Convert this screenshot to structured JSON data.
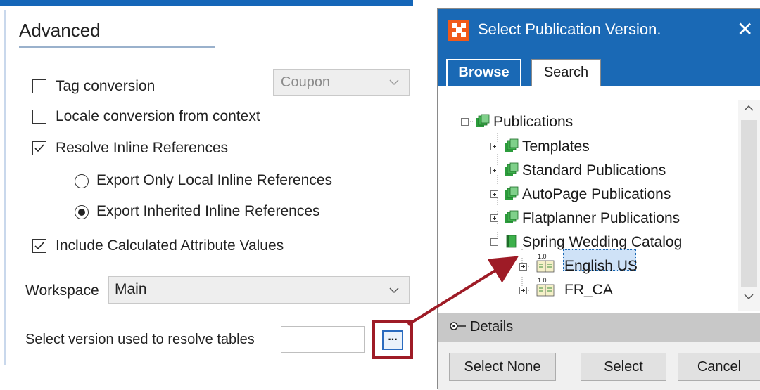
{
  "advanced": {
    "title": "Advanced",
    "tag_conversion": {
      "label": "Tag conversion",
      "checked": false
    },
    "coupon_select": {
      "value": "Coupon"
    },
    "locale_conversion": {
      "label": "Locale conversion from context",
      "checked": false
    },
    "resolve_inline": {
      "label": "Resolve Inline References",
      "checked": true
    },
    "radio_local": {
      "label": "Export Only Local Inline References",
      "selected": false
    },
    "radio_inherited": {
      "label": "Export Inherited Inline References",
      "selected": true
    },
    "include_calculated": {
      "label": "Include Calculated Attribute Values",
      "checked": true
    },
    "workspace": {
      "label": "Workspace",
      "value": "Main"
    },
    "version": {
      "label": "Select version used to resolve tables",
      "value": "",
      "button_label": "..."
    }
  },
  "dialog": {
    "title": "Select Publication Version.",
    "close_label": "✕",
    "tabs": [
      {
        "label": "Browse",
        "active": true
      },
      {
        "label": "Search",
        "active": false
      }
    ],
    "tree": {
      "root": "Publications",
      "items": [
        {
          "label": "Templates"
        },
        {
          "label": "Standard Publications"
        },
        {
          "label": "AutoPage Publications"
        },
        {
          "label": "Flatplanner Publications"
        },
        {
          "label": "Spring Wedding Catalog"
        }
      ],
      "versions": [
        {
          "label": "English US",
          "selected": true,
          "badge": "1.0"
        },
        {
          "label": "FR_CA",
          "selected": false,
          "badge": "1.0"
        }
      ]
    },
    "details_label": "Details",
    "buttons": {
      "select_none": "Select None",
      "select": "Select",
      "cancel": "Cancel"
    }
  },
  "colors": {
    "accent": "#1a69b5",
    "highlight_box": "#9e1b26",
    "logo": "#f05a1a"
  }
}
